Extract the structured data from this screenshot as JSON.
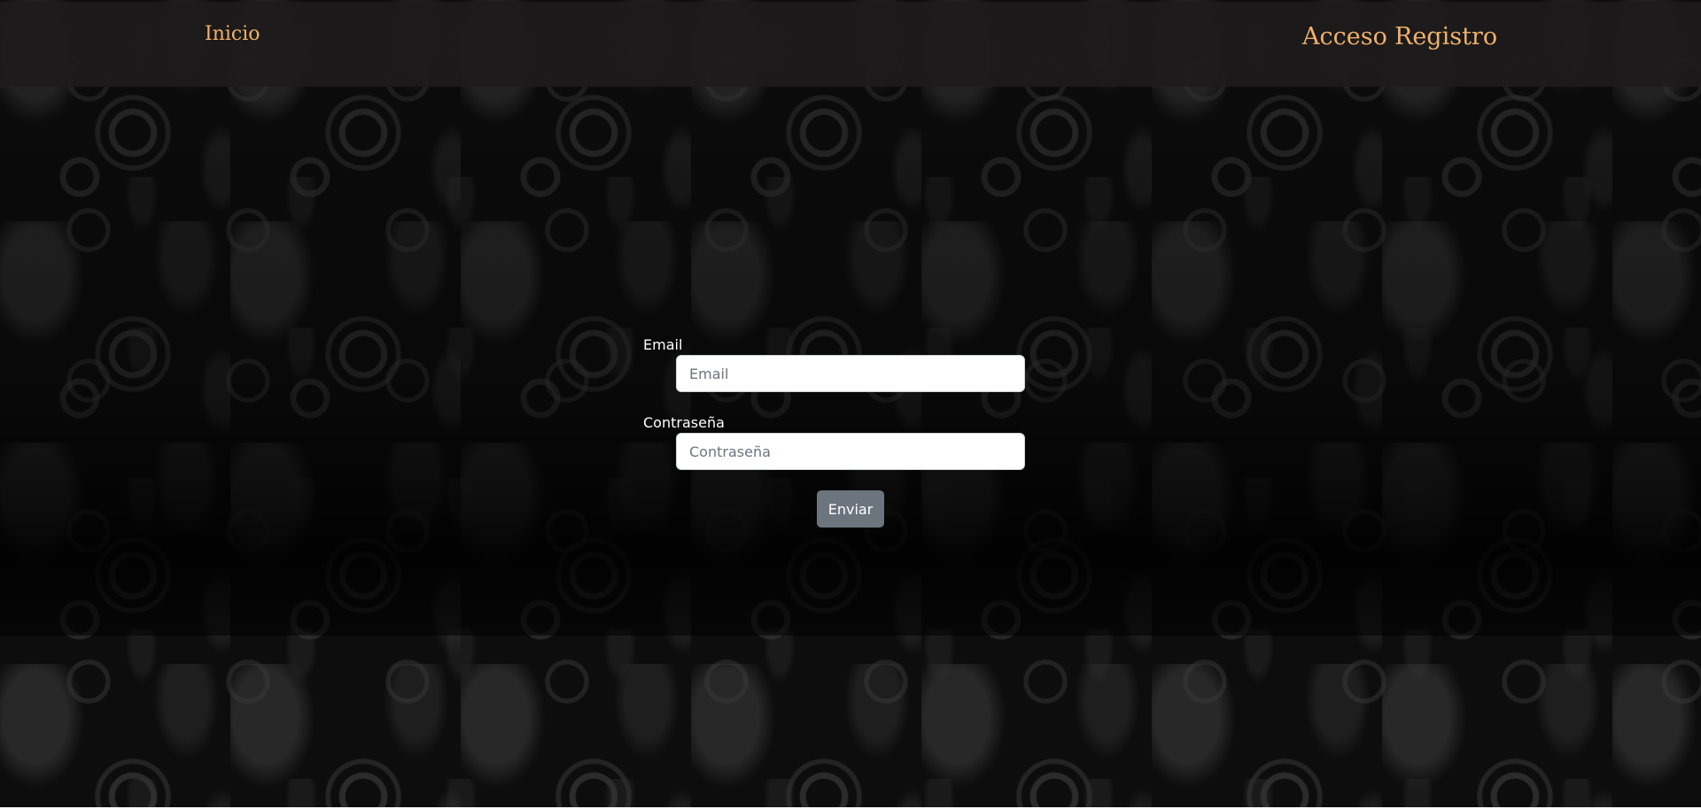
{
  "nav": {
    "home_label": "Inicio",
    "login_label": "Acceso",
    "register_label": "Registro"
  },
  "form": {
    "email_label": "Email",
    "email_placeholder": "Email",
    "password_label": "Contraseña",
    "password_placeholder": "Contraseña",
    "submit_label": "Enviar"
  },
  "colors": {
    "nav_link": "#f0b06a",
    "button": "#6c757d",
    "background": "#0d0d0d"
  }
}
